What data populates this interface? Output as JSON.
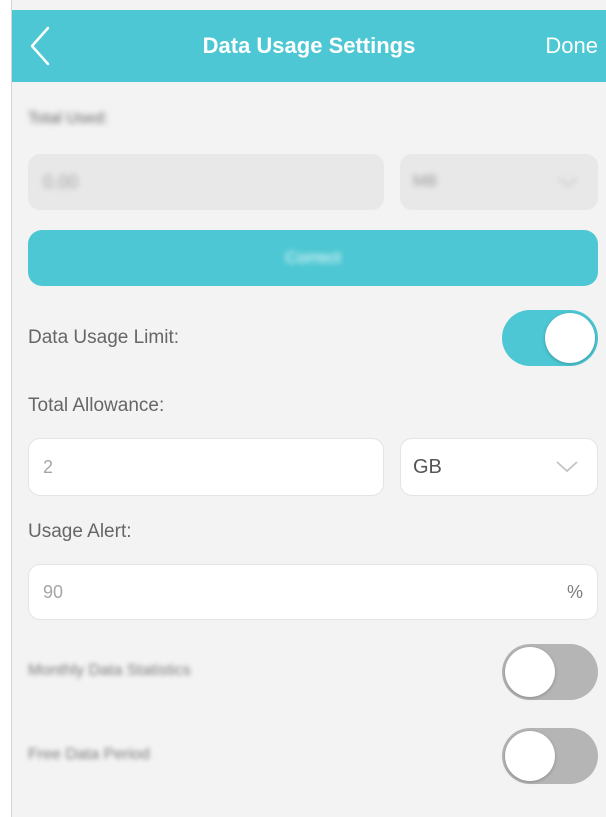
{
  "colors": {
    "accent": "#4cc7d3",
    "background": "#f3f3f3",
    "toggle_off": "#b5b5b5"
  },
  "header": {
    "title": "Data Usage Settings",
    "done_label": "Done",
    "back_icon": "chevron-left-icon"
  },
  "total_used": {
    "label": "Total Used:",
    "value": "0.00",
    "unit": "MB",
    "correct_label": "Correct"
  },
  "data_usage_limit": {
    "label": "Data Usage Limit:",
    "enabled": true
  },
  "total_allowance": {
    "label": "Total Allowance:",
    "placeholder": "2",
    "unit": "GB",
    "dropdown_icon": "chevron-down-icon"
  },
  "usage_alert": {
    "label": "Usage Alert:",
    "placeholder": "90",
    "unit": "%"
  },
  "monthly_statistics": {
    "label": "Monthly Data Statistics",
    "enabled": false
  },
  "free_data_period": {
    "label": "Free Data Period",
    "enabled": false
  }
}
